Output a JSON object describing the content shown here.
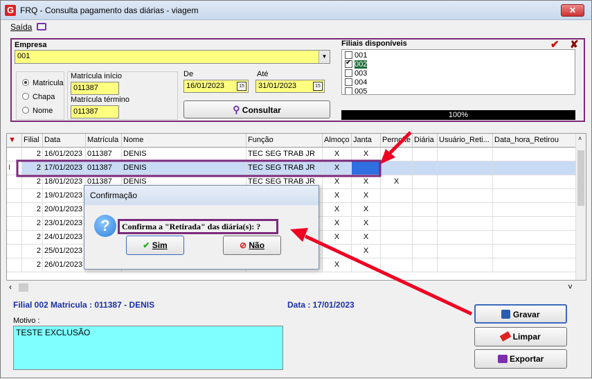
{
  "window": {
    "title": "FRQ - Consulta pagamento das diárias - viagem",
    "logo": "G",
    "close": "✕"
  },
  "menu": {
    "saida": "Saída"
  },
  "filter": {
    "empresa_label": "Empresa",
    "empresa_value": "001",
    "radios": [
      "Matricula",
      "Chapa",
      "Nome"
    ],
    "mat_inicio_label": "Matrícula início",
    "mat_inicio": "011387",
    "mat_termino_label": "Matrícula término",
    "mat_termino": "011387",
    "de_label": "De",
    "de": "16/01/2023",
    "ate_label": "Até",
    "ate": "31/01/2023",
    "consultar": "Consultar",
    "filiais_label": "Filiais disponíveis",
    "filiais": [
      "001",
      "002",
      "003",
      "004",
      "005"
    ],
    "progress": "100%"
  },
  "grid": {
    "headers": [
      "Filial",
      "Data",
      "Matrícula",
      "Nome",
      "Função",
      "Almoço",
      "Janta",
      "Pernoite",
      "Diária",
      "Usuário_Reti...",
      "Data_hora_Retirou"
    ],
    "rows": [
      [
        "2",
        "16/01/2023",
        "011387",
        "DENIS",
        "TEC SEG TRAB JR",
        "X",
        "X",
        "",
        "",
        "",
        ""
      ],
      [
        "2",
        "17/01/2023",
        "011387",
        "DENIS",
        "TEC SEG TRAB JR",
        "X",
        "",
        "",
        "",
        "",
        ""
      ],
      [
        "2",
        "18/01/2023",
        "011387",
        "DENIS",
        "TEC SEG TRAB JR",
        "X",
        "X",
        "X",
        "",
        "",
        ""
      ],
      [
        "2",
        "19/01/2023",
        "",
        "",
        "",
        "X",
        "X",
        "",
        "",
        "",
        ""
      ],
      [
        "2",
        "20/01/2023",
        "",
        "",
        "",
        "X",
        "X",
        "",
        "",
        "",
        ""
      ],
      [
        "2",
        "23/01/2023",
        "",
        "",
        "",
        "X",
        "X",
        "",
        "",
        "",
        ""
      ],
      [
        "2",
        "24/01/2023",
        "",
        "",
        "",
        "X",
        "X",
        "",
        "",
        "",
        ""
      ],
      [
        "2",
        "25/01/2023",
        "",
        "",
        "",
        "",
        "X",
        "",
        "",
        "",
        ""
      ],
      [
        "2",
        "26/01/2023",
        "",
        "",
        "",
        "X",
        "",
        "",
        "",
        "",
        ""
      ]
    ]
  },
  "info": {
    "filial": "Filial 002  Matricula : 011387 - DENIS",
    "data": "Data : 17/01/2023",
    "motivo_label": "Motivo :",
    "motivo": "TESTE EXCLUSÃO"
  },
  "buttons": {
    "gravar": "Gravar",
    "limpar": "Limpar",
    "exportar": "Exportar"
  },
  "dialog": {
    "title": "Confirmação",
    "message": "Confirma a \"Retirada\" das diária(s): ?",
    "sim": "Sim",
    "nao": "Não"
  }
}
